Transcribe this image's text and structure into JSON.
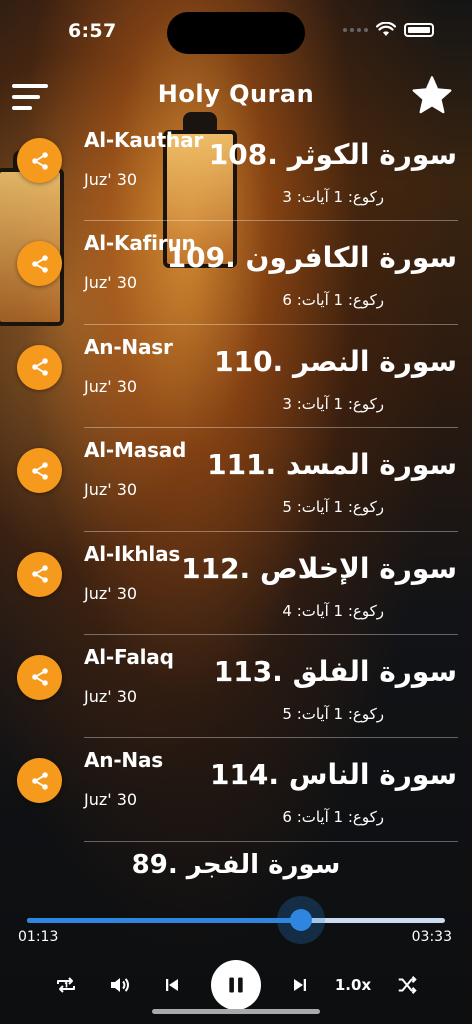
{
  "status": {
    "time": "6:57"
  },
  "header": {
    "title": "Holy Quran",
    "menu_icon": "menu-icon",
    "favorite_icon": "star-icon"
  },
  "surahs": [
    {
      "en": "Al-Kauthar",
      "juz": "Juz' 30",
      "ar": "108. سورة الكوثر",
      "sub": "ركوع: 1 آيات: 3"
    },
    {
      "en": "Al-Kafirun",
      "juz": "Juz' 30",
      "ar": "109. سورة الكافرون",
      "sub": "ركوع: 1 آيات: 6"
    },
    {
      "en": "An-Nasr",
      "juz": "Juz' 30",
      "ar": "110. سورة النصر",
      "sub": "ركوع: 1 آيات: 3"
    },
    {
      "en": "Al-Masad",
      "juz": "Juz' 30",
      "ar": "111. سورة المسد",
      "sub": "ركوع: 1 آيات: 5"
    },
    {
      "en": "Al-Ikhlas",
      "juz": "Juz' 30",
      "ar": "112. سورة الإخلاص",
      "sub": "ركوع: 1 آيات: 4"
    },
    {
      "en": "Al-Falaq",
      "juz": "Juz' 30",
      "ar": "113. سورة الفلق",
      "sub": "ركوع: 1 آيات: 5"
    },
    {
      "en": "An-Nas",
      "juz": "Juz' 30",
      "ar": "114. سورة الناس",
      "sub": "ركوع: 1 آيات: 6"
    }
  ],
  "player": {
    "now_playing": "89. سورة الفجر",
    "elapsed": "01:13",
    "total": "03:33",
    "progress": 0.655,
    "speed": "1.0x",
    "accent": "#2f86e0",
    "share_color": "#f59a1c"
  }
}
